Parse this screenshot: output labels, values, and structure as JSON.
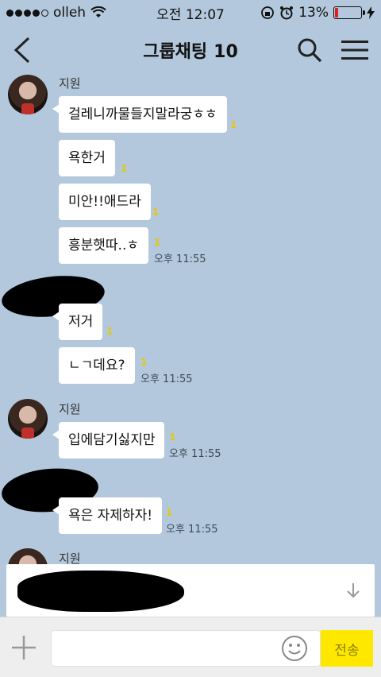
{
  "status": {
    "carrier": "olleh",
    "time": "오전 12:07",
    "battery": "13%",
    "battery_level": 0.13,
    "battery_color": "#e02020"
  },
  "header": {
    "title": "그룹채팅",
    "count": "10",
    "back_icon": "chevron-left-icon",
    "search_icon": "search-icon",
    "menu_icon": "menu-icon"
  },
  "messages": {
    "g1_sender": "지원",
    "m1": "걸레니까물들지말라궁ㅎㅎ",
    "m1_unread": "1",
    "m2": "욕한거",
    "m2_unread": "1",
    "m3": "미안!!애드라",
    "m3_unread": "1",
    "m4": "흥분햇따..ㅎ",
    "m4_unread": "1",
    "m4_time": "오후 11:55",
    "m5": "저거",
    "m5_unread": "1",
    "m6": "ㄴㄱ데요?",
    "m6_unread": "1",
    "m6_time": "오후 11:55",
    "g3_sender": "지원",
    "m7": "입에담기싫지만",
    "m7_unread": "1",
    "m7_time": "오후 11:55",
    "m8": "욕은 자제하자!",
    "m8_unread": "1",
    "m8_time": "오후 11:55",
    "g5_sender": "지원"
  },
  "input": {
    "value": "",
    "send_label": "전송",
    "send_color": "#ffe800"
  }
}
